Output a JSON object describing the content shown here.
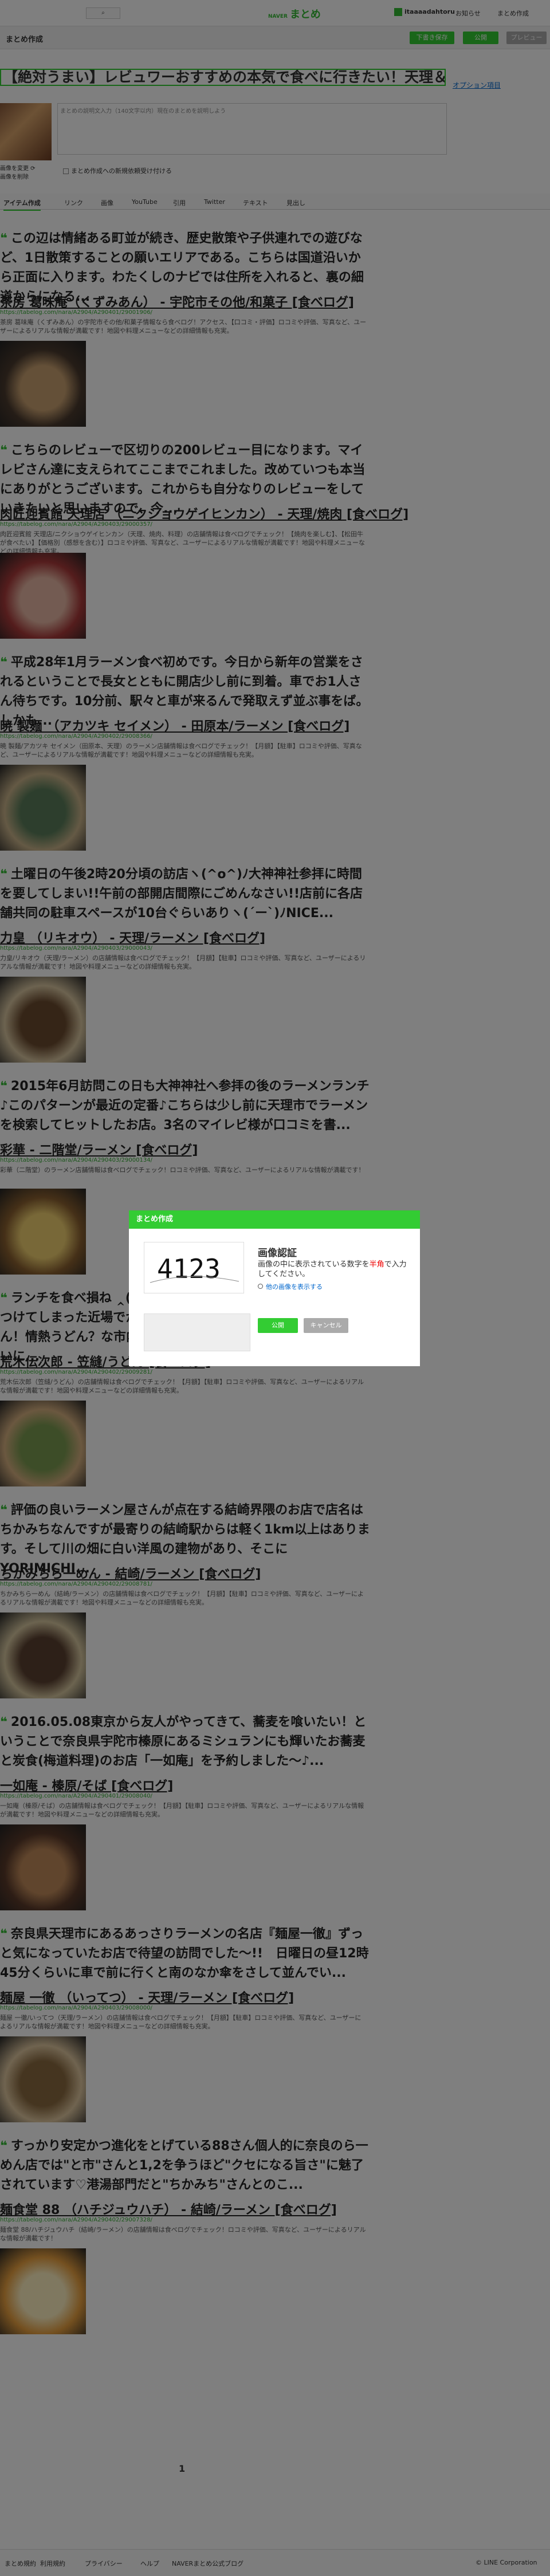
{
  "topbar": {
    "search_icon": "search-icon",
    "logo_small": "NAVER",
    "logo": "まとめ",
    "user": "itaaaadahtoru",
    "links": [
      "お知らせ",
      "まとめ作成"
    ]
  },
  "subbar": {
    "title": "まとめ作成",
    "buttons": [
      "下書き保存",
      "公開",
      "プレビュー"
    ]
  },
  "editor": {
    "title_value": "【絶対うまい】レビュワーおすすめの本気で食べに行きたい！天理＆宇陀",
    "option_link": "オプション項目",
    "thumb_caption": "画像を変更 ⟳",
    "thumb_caption2": "画像を削除",
    "description_placeholder": "まとめの説明文入力（140文字以内）現在のまとめを説明しよう",
    "checkbox_label": "まとめ作成への新規依頼受け付ける"
  },
  "tabs": [
    "アイテム作成",
    "リンク",
    "画像",
    "YouTube",
    "引用",
    "Twitter",
    "テキスト",
    "見出し"
  ],
  "items": [
    {
      "quote": "この辺は情緒ある町並が続き、歴史散策や子供連れでの遊びなど、1日散策することの願いエリアである。こちらは国道沿いから正面に入ります。わたくしのナビでは住所を入れると、裏の細道からになる...",
      "title": "茶房 葛味庵（くずみあん） - 宇陀市その他/和菓子 [食べログ]",
      "url": "https://tabelog.com/nara/A2904/A290401/29001906/",
      "desc": "茶房 葛味庵（くずみあん）の宇陀市その他/和菓子情報なら食べログ！アクセス、【口コミ・評価】ロコミや評価、写真など、ユーザーによるリアルな情報が満載です！地図や料理メニューなどの詳細情報も充実。"
    },
    {
      "quote": "こちらのレビューで区切りの200レビュー目になります。マイレビさん達に支えられてここまでこれました。改めていつも本当にありがとうございます。これからも自分なりのレビューをしていきたいと思いますので、今...",
      "title": "肉匠迎賓館 天理店 （ニクショウゲイヒンカン） - 天理/焼肉 [食べログ]",
      "url": "https://tabelog.com/nara/A2904/A290403/29000357/",
      "desc": "肉匠迎賓館 天理店/ニクショウゲイヒンカン（天理、焼肉、料理）の店舗情報は食べログでチェック！【焼肉を楽しむ】、【松田牛が食べたい】【価格別（感想を含む）】ロコミや評価、写真など、ユーザーによるリアルな情報が満載です！地図や料理メニューなどの詳細情報も充実。"
    },
    {
      "quote": "平成28年1月ラーメン食べ初めです。今日から新年の営業をされるということで長女とともに開店少し前に到着。車でお1人さん待ちです。10分前、駅々と車が来るんで発取えず並ぶ事をば。しかも...",
      "title": "暁 製麺 （アカツキ セイメン） - 田原本/ラーメン [食べログ]",
      "url": "https://tabelog.com/nara/A2904/A290402/29008366/",
      "desc": "暁 製麺/アカツキ セイメン（田原本、天理）のラーメン店舗情報は食べログでチェック！【月額】【駐車】ロコミや評価、写真など、ユーザーによるリアルな情報が満載です！地図や料理メニューなどの詳細情報も充実。"
    },
    {
      "quote": "土曜日の午後2時20分頃の訪店ヽ(^o^)ﾉ大神神社参拝に時間を要してしまい!!午前の部開店間際にごめんなさい!!店前に各店舗共同の駐車スペースが10台ぐらいありヽ(´ー`)ﾉNICE...",
      "title": "力皇 （リキオウ） - 天理/ラーメン [食べログ]",
      "url": "https://tabelog.com/nara/A2904/A290403/29000043/",
      "desc": "力皇/リキオウ（天理/ラーメン）の店舗情報は食べログでチェック！【月額】【駐車】ロコミや評価、写真など、ユーザーによるリアルな情報が満載です！地図や料理メニューなどの詳細情報も充実。"
    },
    {
      "quote": "2015年6月訪問この日も大神神社へ参拝の後のラーメンランチ♪このパターンが最近の定番♪こちらは少し前に天理市でラーメンを検索してヒットしたお店。3名のマイレビ様が口コミを書...",
      "title": "彩華 - 二階堂/ラーメン [食べログ]",
      "url": "https://tabelog.com/nara/A2904/A290403/29000134/",
      "desc": "彩華（二階堂）のラーメン店舗情報は食べログでチェック！ロコミや評価、写真など、ユーザーによるリアルな情報が満載です！"
    },
    {
      "quote": "ランチを食べ損ね ‸(′-`)‸ 新規へ。さがになりいほどの方にぶつけてしまった近場でかなり高得点なお店を発見！荒木伝次郎さん！情熱うどん？な市内へ夜の部は１８時からだったので辛くらいに...",
      "title": "荒木伝次郎 - 笠縫/うどん [食べログ]",
      "url": "https://tabelog.com/nara/A2904/A290402/29009281/",
      "desc": "荒木伝次郎（笠縫/うどん）の店舗情報は食べログでチェック！【月額】【駐車】ロコミや評価、写真など、ユーザーによるリアルな情報が満載です！地図や料理メニューなどの詳細情報も充実。"
    },
    {
      "quote": "評価の良いラーメン屋さんが点在する結崎界隈のお店で店名はちかみちなんですが最寄りの結崎駅からは軽く1km以上はあります。そして川の畑に白い洋風の建物があり、そこにYORIMICHI...",
      "title": "ちかみちら一めん - 結崎/ラーメン [食べログ]",
      "url": "https://tabelog.com/nara/A2904/A290402/29008781/",
      "desc": "ちかみちら一めん（結崎/ラーメン）の店舗情報は食べログでチェック！【月額】【駐車】ロコミや評価、写真など、ユーザーによるリアルな情報が満載です！地図や料理メニューなどの詳細情報も充実。"
    },
    {
      "quote": "2016.05.08東京から友人がやってきて、蕎麦を喰いたい！ということで奈良県宇陀市榛原にあるミシュランにも輝いたお蕎麦と炭食(梅道料理)のお店「一如庵」を予約しました〜♪...",
      "title": "一如庵 - 榛原/そば [食べログ]",
      "url": "https://tabelog.com/nara/A2904/A290401/29008040/",
      "desc": "一如庵（榛原/そば）の店舗情報は食べログでチェック！【月額】【駐車】ロコミや評価、写真など、ユーザーによるリアルな情報が満載です！地図や料理メニューなどの詳細情報も充実。"
    },
    {
      "quote": "奈良県天理市にあるあっさりラーメンの名店『麺屋一徹』ずっと気になっていたお店で待望の訪問でした〜!!　日曜日の昼12時45分くらいに車で前に行くと南のなか傘をさして並んでい...",
      "title": "麺屋 一徹 （いってつ） - 天理/ラーメン [食べログ]",
      "url": "https://tabelog.com/nara/A2904/A290403/29008000/",
      "desc": "麺屋 一徹/いってつ（天理/ラーメン）の店舗情報は食べログでチェック！【月額】【駐車】ロコミや評価、写真など、ユーザーによるリアルな情報が満載です！地図や料理メニューなどの詳細情報も充実。"
    },
    {
      "quote": "すっかり安定かつ進化をとげている88さん個人的に奈良のら一めん店では\"と市\"さんと1,2を争うほど\"クセになる旨さ\"に魅了されています♡港湯部門だと\"ちかみち\"さんとのこ...",
      "title": "麺食堂 88 （ハチジュウハチ） - 結崎/ラーメン [食べログ]",
      "url": "https://tabelog.com/nara/A2904/A290402/29007328/",
      "desc": "麺食堂 88/ハチジュウハチ（結崎/ラーメン）の店舗情報は食べログでチェック！ロコミや評価、写真など、ユーザーによるリアルな情報が満載です！"
    }
  ],
  "pager": "1",
  "footer": [
    "まとめ規約",
    "利用規約",
    "プライバシー",
    "ヘルプ",
    "NAVERまとめ公式ブログ",
    "© LINE Corporation"
  ],
  "modal": {
    "title": "まとめ作成",
    "captcha_text": "4123",
    "label": "画像認証",
    "instruction_pre": "画像の中に表示されている数字を",
    "instruction_em": "半角",
    "instruction_post": "で入力してください。",
    "alt_link": "他の画像を表示する",
    "submit": "公開",
    "cancel": "キャンセル"
  },
  "colors": {
    "accent": "#33cc33",
    "link": "#0066cc",
    "overlay": "rgba(0,0,0,0.5)"
  }
}
